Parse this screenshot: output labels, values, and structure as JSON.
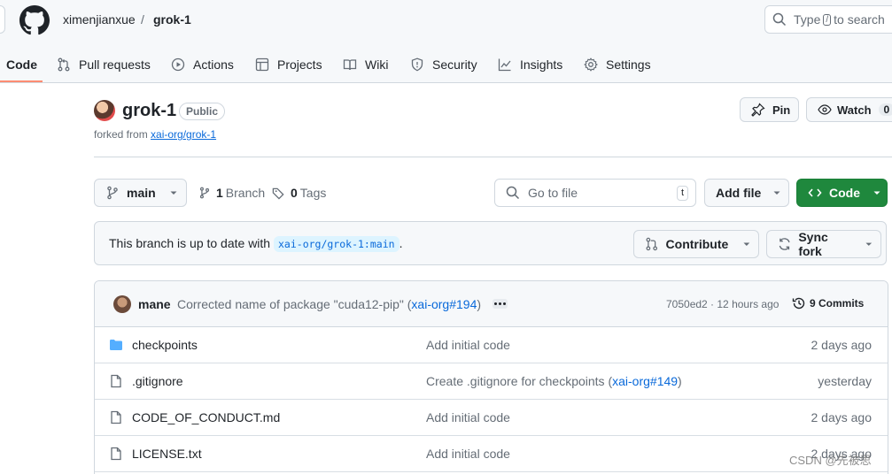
{
  "header": {
    "owner": "ximenjianxue",
    "separator": "/",
    "repo": "grok-1",
    "search": {
      "prefix": "Type",
      "key": "/",
      "suffix": "to search"
    }
  },
  "nav": {
    "tabs": [
      {
        "label": "Code",
        "icon": "code-icon"
      },
      {
        "label": "Pull requests",
        "icon": "pull-request-icon"
      },
      {
        "label": "Actions",
        "icon": "play-icon"
      },
      {
        "label": "Projects",
        "icon": "table-icon"
      },
      {
        "label": "Wiki",
        "icon": "book-icon"
      },
      {
        "label": "Security",
        "icon": "shield-icon"
      },
      {
        "label": "Insights",
        "icon": "graph-icon"
      },
      {
        "label": "Settings",
        "icon": "gear-icon"
      }
    ]
  },
  "repo": {
    "title": "grok-1",
    "visibility": "Public",
    "forked_label": "forked from",
    "forked_source": "xai-org/grok-1",
    "pin_label": "Pin",
    "watch_label": "Watch",
    "watch_count": "0"
  },
  "toolbar": {
    "branch": "main",
    "branch_count": "1",
    "branch_label": "Branch",
    "tag_count": "0",
    "tag_label": "Tags",
    "goto_placeholder": "Go to file",
    "goto_key": "t",
    "add_file": "Add file",
    "code": "Code"
  },
  "banner": {
    "text": "This branch is up to date with",
    "ref": "xai-org/grok-1:main",
    "period": ".",
    "contribute": "Contribute",
    "sync_fork": "Sync fork"
  },
  "commit": {
    "author": "mane",
    "message": "Corrected name of package \"cuda12-pip\" (",
    "link": "xai-org#194",
    "close": ")",
    "hash_time": "7050ed2 · 12 hours ago",
    "commits_count": "9 Commits"
  },
  "files": [
    {
      "name": "checkpoints",
      "type": "folder",
      "msg": "Add initial code",
      "link": "",
      "tail": "",
      "date": "2 days ago"
    },
    {
      "name": ".gitignore",
      "type": "file",
      "msg": "Create .gitignore for checkpoints (",
      "link": "xai-org#149",
      "tail": ")",
      "date": "yesterday"
    },
    {
      "name": "CODE_OF_CONDUCT.md",
      "type": "file",
      "msg": "Add initial code",
      "link": "",
      "tail": "",
      "date": "2 days ago"
    },
    {
      "name": "LICENSE.txt",
      "type": "file",
      "msg": "Add initial code",
      "link": "",
      "tail": "",
      "date": "2 days ago"
    }
  ],
  "watermark": "CSDN @先被思",
  "colors": {
    "accent_green": "#1f883d",
    "link_blue": "#0969da",
    "tab_underline": "#fd8c73",
    "folder_blue": "#54aeff"
  }
}
